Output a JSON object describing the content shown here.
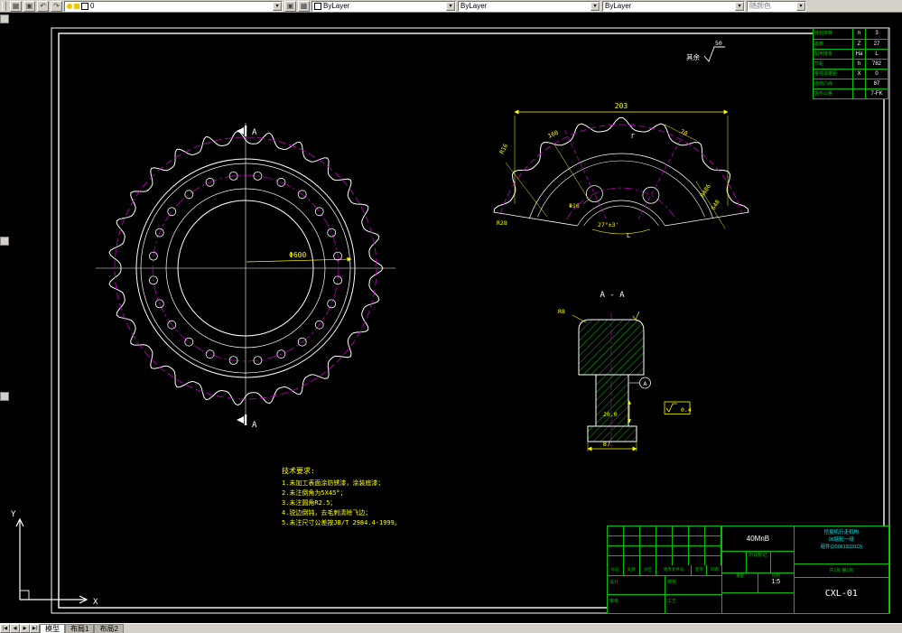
{
  "window": {
    "toolbar": {
      "icon_glyphs": [
        "▦",
        "▣",
        "↶",
        "↷"
      ],
      "layer_glyphs": [
        "●",
        "●",
        "■"
      ],
      "layer_value": "0",
      "color_value": "ByLayer",
      "linetype_value": "ByLayer",
      "lineweight_value": "ByLayer",
      "plot_style_value": "随颜色",
      "dropdown_arrow": "▾"
    },
    "status_tabs": {
      "nav": [
        "|◀",
        "◀",
        "▶",
        "▶|"
      ],
      "model": "模型",
      "layout1": "布局1",
      "layout2": "布局2"
    }
  },
  "drawing": {
    "surface_note": {
      "prefix": "其余",
      "value": "50"
    },
    "front": {
      "section_a": "A",
      "dim_diameter": "Φ600"
    },
    "detail": {
      "dims": {
        "top": "203",
        "right": "70",
        "left_r": "R16",
        "left_d": "160",
        "hole": "Φ16",
        "angle": "27°±3'",
        "stack1": "R486",
        "stack2": "648",
        "bottom_left": "R28"
      },
      "mark_top": "Γ",
      "mark_bottom": "L"
    },
    "section": {
      "label": "A - A",
      "radius": "R8",
      "depth": "20.0",
      "width": "87",
      "roughness": "0.4",
      "datum": "A"
    },
    "tech_req": {
      "title": "技术要求:",
      "lines": [
        "1.未加工表面涂防锈漆，涂装底漆；",
        "2.未注倒角为5X45°；",
        "3.未注圆角R2.5；",
        "4.锐边倒钝，去毛刺清除飞边；",
        "5.未注尺寸公差按JB/T 2984.4-1999。"
      ]
    },
    "param_table": {
      "rows": [
        {
          "label": "链轮排数",
          "sym": "n",
          "val": "3"
        },
        {
          "label": "齿数",
          "sym": "Z",
          "val": "27"
        },
        {
          "label": "配用链条",
          "sym": "Ha",
          "val": "L"
        },
        {
          "label": "节距",
          "sym": "h",
          "val": "782"
        },
        {
          "label": "量柱测量距",
          "sym": "X",
          "val": "0"
        },
        {
          "label": "齿侧凸缘",
          "sym": "",
          "val": "87"
        },
        {
          "label": "齿形公差",
          "sym": "",
          "val": "7-FK"
        }
      ]
    },
    "title_block": {
      "material": "40MnB",
      "stage_label": "阶段标记",
      "weight_label": "重量",
      "scale_label": "比例",
      "scale": "1:5",
      "sheet": "共1张 第1张",
      "drawing_no": "CXL-01",
      "product_lines": [
        "挖掘机行走机构",
        "06链轮一组",
        "组件(200618331D)"
      ],
      "rev_headers": [
        "标记",
        "处数",
        "分区",
        "更改文件号",
        "签字",
        "日期"
      ],
      "sig_labels": [
        "设计",
        "校核",
        "审核",
        "工艺"
      ]
    },
    "ucs": {
      "x": "X",
      "y": "Y"
    }
  }
}
